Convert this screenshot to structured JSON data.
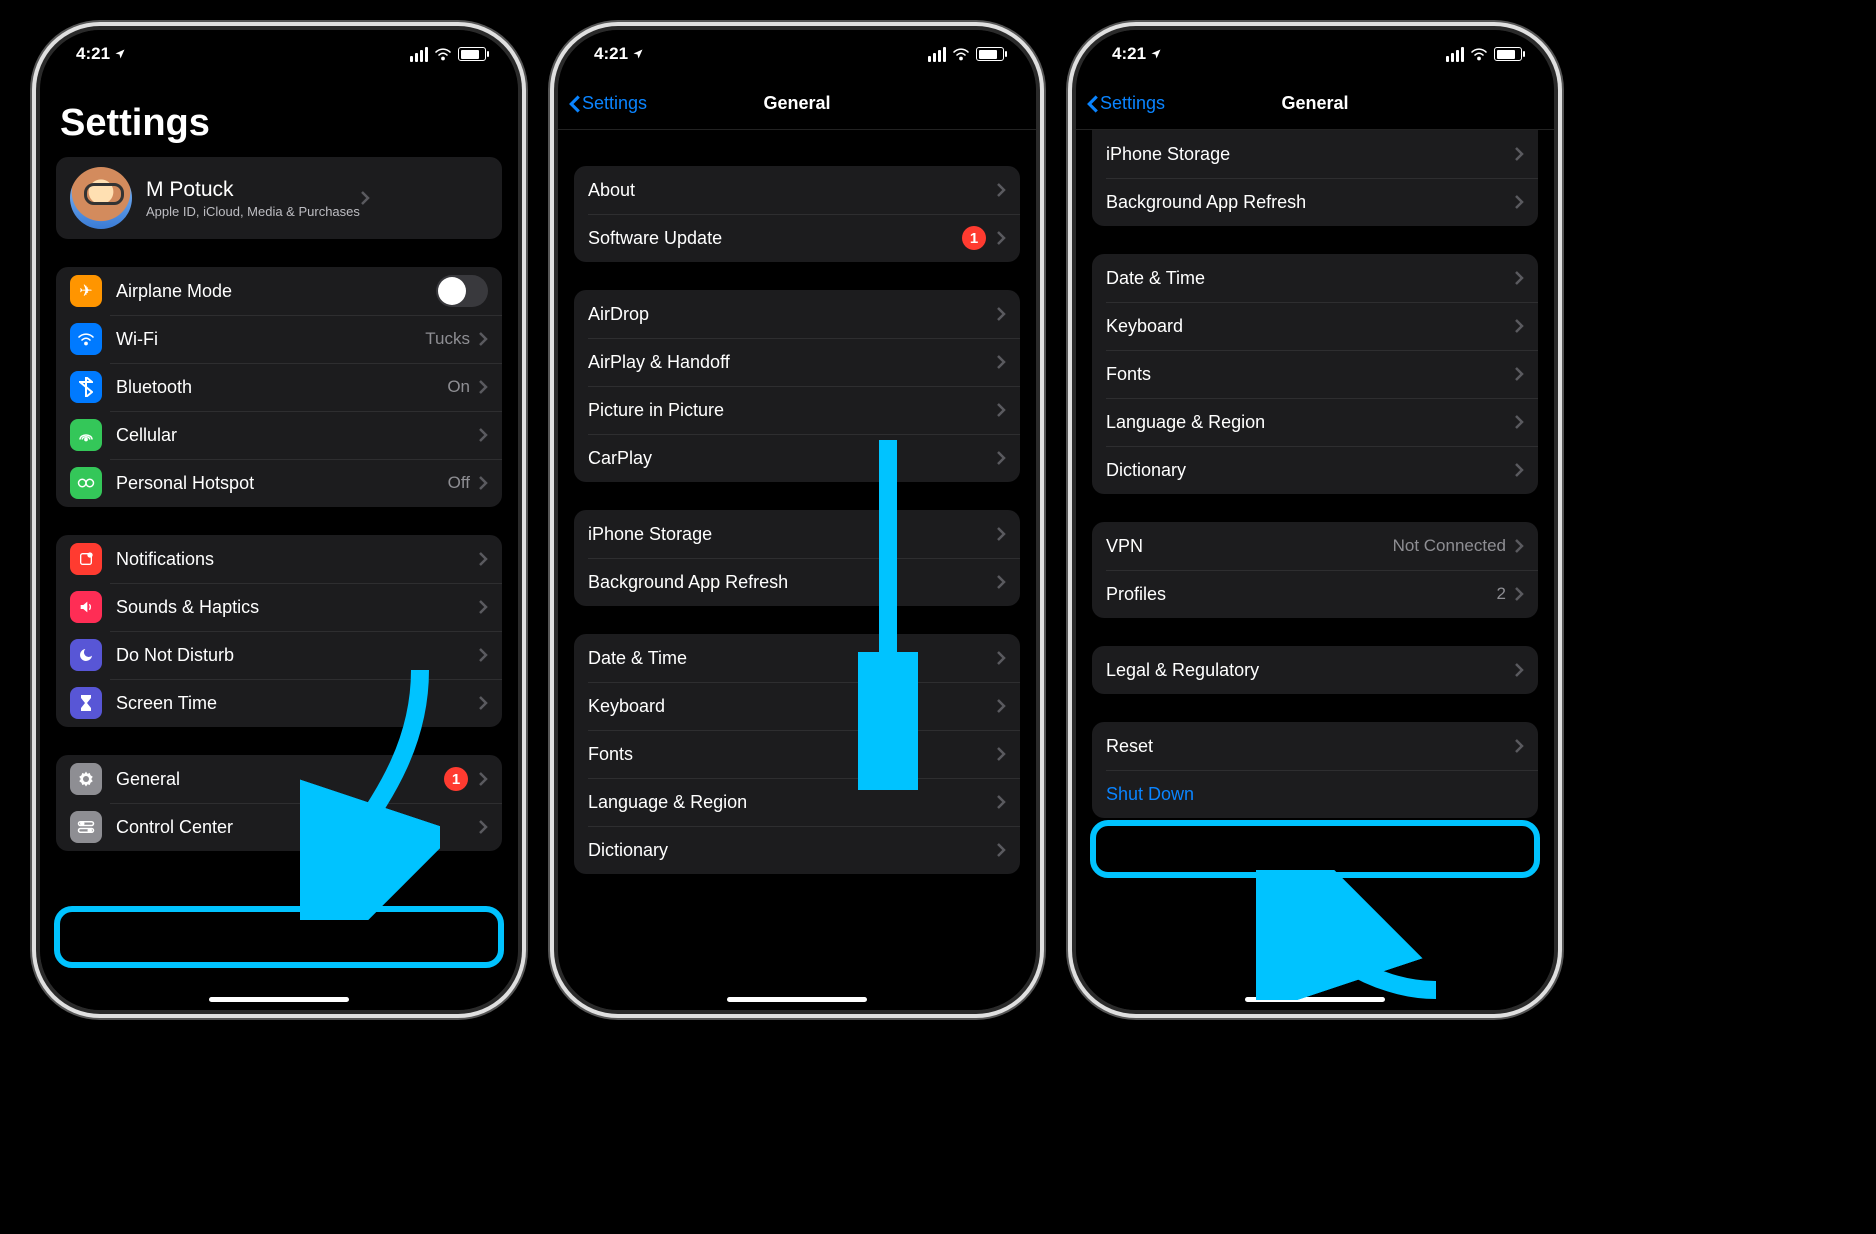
{
  "status": {
    "time": "4:21",
    "loc_arrow": "➤"
  },
  "colors": {
    "accent": "#0a84ff",
    "badge": "#ff3b30",
    "highlight": "#00c3ff"
  },
  "screen1": {
    "title": "Settings",
    "profile": {
      "name": "M Potuck",
      "sub": "Apple ID, iCloud, Media & Purchases"
    },
    "net_group": [
      {
        "icon": "airplane",
        "label": "Airplane Mode",
        "toggle": true
      },
      {
        "icon": "wifi",
        "label": "Wi-Fi",
        "detail": "Tucks"
      },
      {
        "icon": "bt",
        "label": "Bluetooth",
        "detail": "On"
      },
      {
        "icon": "cell",
        "label": "Cellular"
      },
      {
        "icon": "hotspot",
        "label": "Personal Hotspot",
        "detail": "Off"
      }
    ],
    "alerts_group": [
      {
        "icon": "notif",
        "label": "Notifications"
      },
      {
        "icon": "sound",
        "label": "Sounds & Haptics"
      },
      {
        "icon": "dnd",
        "label": "Do Not Disturb"
      },
      {
        "icon": "screen",
        "label": "Screen Time"
      }
    ],
    "general_group": [
      {
        "icon": "gear",
        "label": "General",
        "badge": "1"
      },
      {
        "icon": "cc",
        "label": "Control Center"
      }
    ]
  },
  "screen2": {
    "back": "Settings",
    "title": "General",
    "g1": [
      {
        "label": "About"
      },
      {
        "label": "Software Update",
        "badge": "1"
      }
    ],
    "g2": [
      {
        "label": "AirDrop"
      },
      {
        "label": "AirPlay & Handoff"
      },
      {
        "label": "Picture in Picture"
      },
      {
        "label": "CarPlay"
      }
    ],
    "g3": [
      {
        "label": "iPhone Storage"
      },
      {
        "label": "Background App Refresh"
      }
    ],
    "g4": [
      {
        "label": "Date & Time"
      },
      {
        "label": "Keyboard"
      },
      {
        "label": "Fonts"
      },
      {
        "label": "Language & Region"
      },
      {
        "label": "Dictionary"
      }
    ]
  },
  "screen3": {
    "back": "Settings",
    "title": "General",
    "g1": [
      {
        "label": "iPhone Storage"
      },
      {
        "label": "Background App Refresh"
      }
    ],
    "g2": [
      {
        "label": "Date & Time"
      },
      {
        "label": "Keyboard"
      },
      {
        "label": "Fonts"
      },
      {
        "label": "Language & Region"
      },
      {
        "label": "Dictionary"
      }
    ],
    "g3": [
      {
        "label": "VPN",
        "detail": "Not Connected"
      },
      {
        "label": "Profiles",
        "detail": "2"
      }
    ],
    "g4": [
      {
        "label": "Legal & Regulatory"
      }
    ],
    "g5": [
      {
        "label": "Reset"
      },
      {
        "label": "Shut Down",
        "link": true,
        "nochev": true
      }
    ]
  }
}
